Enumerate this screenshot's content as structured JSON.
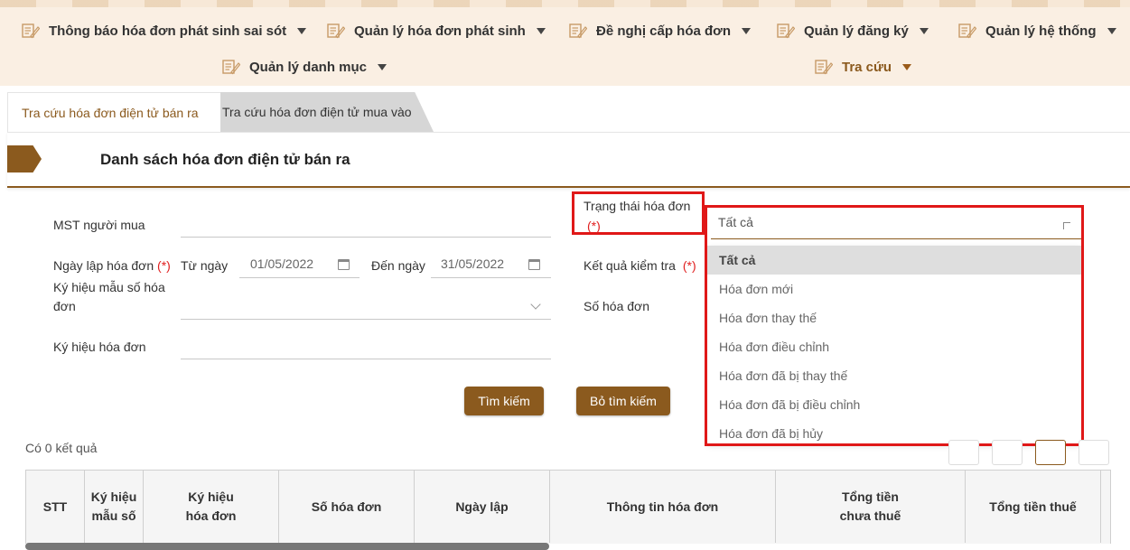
{
  "nav": {
    "items": [
      {
        "label": "Thông báo hóa đơn phát sinh sai sót",
        "icon": "edit-document-icon"
      },
      {
        "label": "Quản lý hóa đơn phát sinh",
        "icon": "edit-document-icon"
      },
      {
        "label": "Đề nghị cấp hóa đơn",
        "icon": "edit-document-icon"
      },
      {
        "label": "Quản lý đăng ký",
        "icon": "edit-document-icon"
      },
      {
        "label": "Quản lý hệ thống",
        "icon": "edit-document-icon"
      },
      {
        "label": "Quản lý danh mục",
        "icon": "edit-document-icon"
      },
      {
        "label": "Tra cứu",
        "icon": "edit-document-icon",
        "active": true
      }
    ]
  },
  "tabs": [
    {
      "label": "Tra cứu hóa đơn điện tử bán ra",
      "active": true
    },
    {
      "label": "Tra cứu hóa đơn điện tử mua vào",
      "active": false
    }
  ],
  "panel": {
    "title": "Danh sách hóa đơn điện tử bán ra"
  },
  "form": {
    "mst_label": "MST người mua",
    "date_label": "Ngày lập hóa đơn",
    "required_mark": "(*)",
    "from_label": "Từ ngày",
    "from_value": "01/05/2022",
    "to_label": "Đến ngày",
    "to_value": "31/05/2022",
    "template_label_1": "Ký hiệu mẫu số hóa",
    "template_label_2": "đơn",
    "symbol_label": "Ký hiệu hóa đơn",
    "status_label": "Trạng thái hóa đơn",
    "check_label": "Kết quả kiểm tra",
    "number_label": "Số hóa đơn"
  },
  "status_select": {
    "value": "Tất cả",
    "options": [
      "Tất cả",
      "Hóa đơn mới",
      "Hóa đơn thay thế",
      "Hóa đơn điều chỉnh",
      "Hóa đơn đã bị thay thế",
      "Hóa đơn đã bị điều chỉnh",
      "Hóa đơn đã bị hủy"
    ]
  },
  "buttons": {
    "search": "Tìm kiếm",
    "clear": "Bỏ tìm kiếm"
  },
  "results": {
    "count_text": "Có 0 kết quả"
  },
  "table": {
    "headers": [
      [
        "STT"
      ],
      [
        "Ký hiệu",
        "mẫu số"
      ],
      [
        "Ký hiệu",
        "hóa đơn"
      ],
      [
        "Số hóa đơn"
      ],
      [
        "Ngày lập"
      ],
      [
        "Thông tin hóa đơn"
      ],
      [
        "Tổng tiền",
        "chưa thuế"
      ],
      [
        "Tổng tiền thuế"
      ]
    ]
  },
  "colors": {
    "brand": "#8b5a1e",
    "nav_bg": "#faefe3",
    "highlight": "#e01818"
  }
}
